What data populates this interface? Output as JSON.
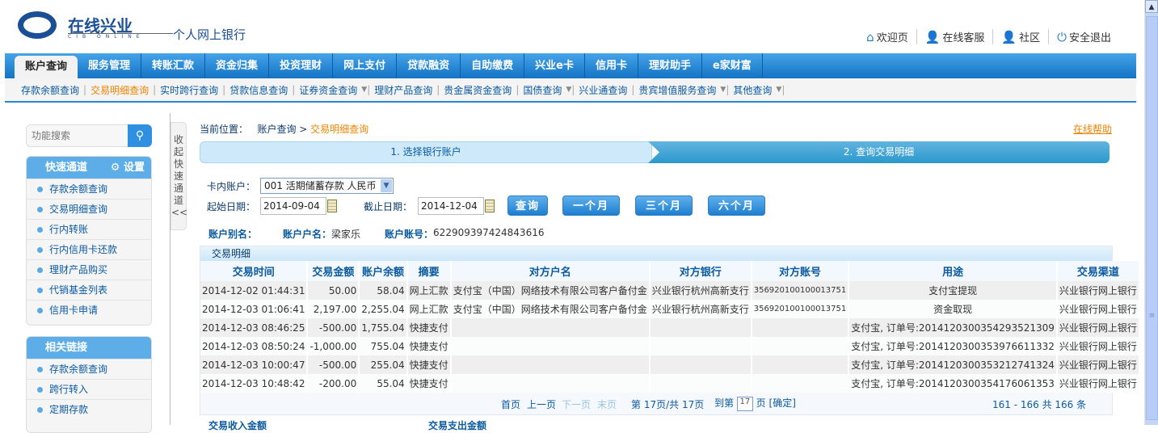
{
  "logo": {
    "text": "在线兴业",
    "sub": "CIB ONLINE",
    "title": "个人网上银行"
  },
  "toplinks": [
    {
      "label": "欢迎页",
      "icon": "home-icon"
    },
    {
      "label": "在线客服",
      "icon": "user-icon"
    },
    {
      "label": "社区",
      "icon": "user-icon"
    },
    {
      "label": "安全退出",
      "icon": "power-icon"
    }
  ],
  "nav": [
    "账户查询",
    "服务管理",
    "转账汇款",
    "资金归集",
    "投资理财",
    "网上支付",
    "贷款融资",
    "自助缴费",
    "兴业e卡",
    "信用卡",
    "理财助手",
    "e家财富"
  ],
  "subnav": [
    {
      "label": "存款余额查询"
    },
    {
      "label": "交易明细查询",
      "active": true
    },
    {
      "label": "实时跨行查询"
    },
    {
      "label": "贷款信息查询"
    },
    {
      "label": "证券资金查询",
      "dd": true
    },
    {
      "label": "理财产品查询"
    },
    {
      "label": "贵金属资金查询"
    },
    {
      "label": "国债查询",
      "dd": true
    },
    {
      "label": "兴业通查询"
    },
    {
      "label": "贵宾增值服务查询",
      "dd": true
    },
    {
      "label": "其他查询",
      "dd": true
    }
  ],
  "sidebar": {
    "search_placeholder": "功能搜索",
    "quick_title": "快速通道",
    "settings": "设置",
    "quick": [
      "存款余额查询",
      "交易明细查询",
      "行内转账",
      "行内信用卡还款",
      "理财产品购买",
      "代销基金列表",
      "信用卡申请"
    ],
    "related_title": "相关链接",
    "related": [
      "存款余额查询",
      "跨行转入",
      "定期存款"
    ],
    "collapse": "收起快速通道"
  },
  "breadcrumb": {
    "label": "当前位置：",
    "parent": "账户查询",
    "current": "交易明细查询"
  },
  "help": "在线帮助",
  "steps": [
    "1. 选择银行账户",
    "2. 查询交易明细"
  ],
  "form": {
    "account_label": "卡内账户：",
    "account_value": "001 活期储蓄存款 人民币",
    "start_label": "起始日期：",
    "start": "2014-09-04",
    "end_label": "截止日期：",
    "end": "2014-12-04",
    "query": "查询",
    "m1": "一个月",
    "m3": "三个月",
    "m6": "六个月"
  },
  "info": {
    "alias_label": "账户别名：",
    "alias": "",
    "name_label": "账户户名：",
    "name": "梁家乐",
    "no_label": "账户账号：",
    "no": "622909397424843616"
  },
  "table": {
    "title": "交易明细",
    "headers": [
      "交易时间",
      "交易金额",
      "账户余额",
      "摘要",
      "对方户名",
      "对方银行",
      "对方账号",
      "用途",
      "交易渠道"
    ],
    "rows": [
      [
        "2014-12-02 01:44:31",
        "50.00",
        "58.04",
        "网上汇款",
        "支付宝（中国）网络技术有限公司客户备付金",
        "兴业银行杭州高新支行",
        "356920100100013751",
        "支付宝提现",
        "兴业银行网上银行"
      ],
      [
        "2014-12-03 01:06:41",
        "2,197.00",
        "2,255.04",
        "网上汇款",
        "支付宝（中国）网络技术有限公司客户备付金",
        "兴业银行杭州高新支行",
        "356920100100013751",
        "资金取现",
        "兴业银行网上银行"
      ],
      [
        "2014-12-03 08:46:25",
        "-500.00",
        "1,755.04",
        "快捷支付",
        "",
        "",
        "",
        "支付宝, 订单号:201412030035429352130​9",
        "兴业银行网上银行"
      ],
      [
        "2014-12-03 08:50:24",
        "-1,000.00",
        "755.04",
        "快捷支付",
        "",
        "",
        "",
        "支付宝, 订单号:2014120300353976611332",
        "兴业银行网上银行"
      ],
      [
        "2014-12-03 10:00:47",
        "-500.00",
        "255.04",
        "快捷支付",
        "",
        "",
        "",
        "支付宝, 订单号:2014120300353212741324",
        "兴业银行网上银行"
      ],
      [
        "2014-12-03 10:48:42",
        "-200.00",
        "55.04",
        "快捷支付",
        "",
        "",
        "",
        "支付宝, 订单号:2014120300354176061353",
        "兴业银行网上银行"
      ]
    ]
  },
  "pager": {
    "first": "首页",
    "prev": "上一页",
    "next": "下一页",
    "last": "末页",
    "page_info": "第 17页/共 17页",
    "goto": "到第",
    "goto_value": "17",
    "page": "页",
    "confirm": "[确定]",
    "range": "161 - 166  共 166 条"
  },
  "bottom": {
    "income": "交易收入金额",
    "expense": "交易支出金额"
  }
}
